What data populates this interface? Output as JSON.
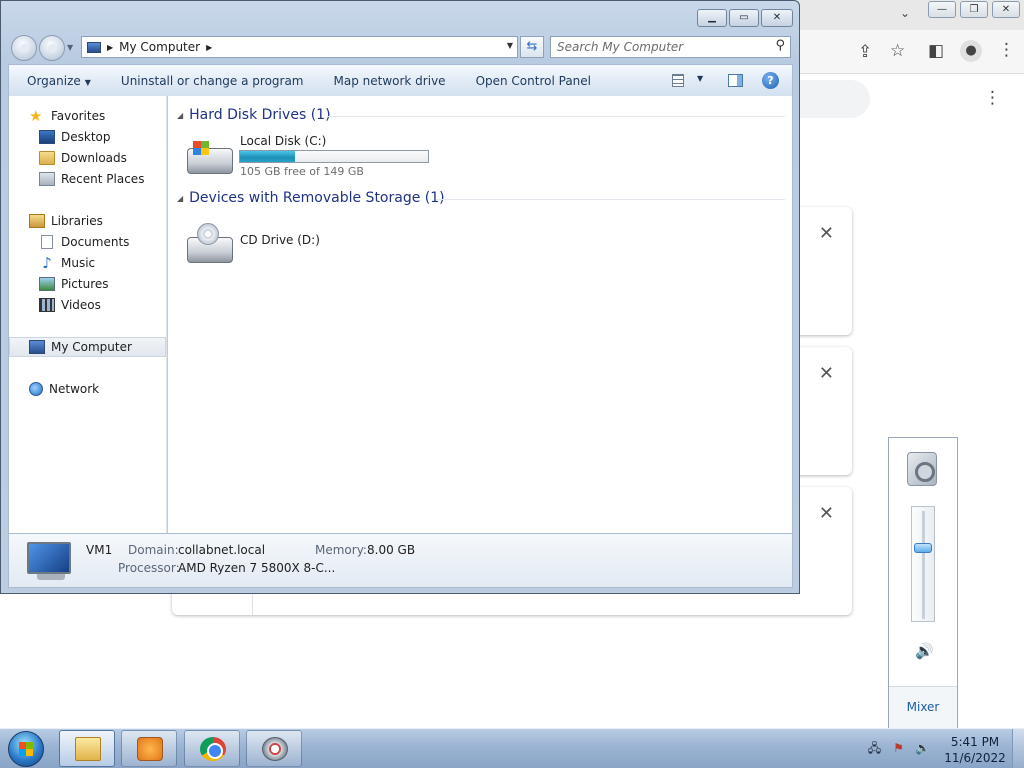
{
  "explorer": {
    "address": {
      "location": "My Computer"
    },
    "search": {
      "placeholder": "Search My Computer"
    },
    "toolbar": {
      "organize": "Organize",
      "uninstall": "Uninstall or change a program",
      "map_drive": "Map network drive",
      "control_panel": "Open Control Panel"
    },
    "nav": {
      "favorites": "Favorites",
      "desktop": "Desktop",
      "downloads": "Downloads",
      "recent": "Recent Places",
      "libraries": "Libraries",
      "documents": "Documents",
      "music": "Music",
      "pictures": "Pictures",
      "videos": "Videos",
      "computer": "My Computer",
      "network": "Network"
    },
    "groups": {
      "hdd_title": "Hard Disk Drives (1)",
      "removable_title": "Devices with Removable Storage (1)"
    },
    "drives": {
      "c_name": "Local Disk (C:)",
      "c_free": "105 GB free of 149 GB",
      "c_used_fraction": 0.295,
      "d_name": "CD Drive (D:)"
    },
    "details": {
      "computer_name": "VM1",
      "domain_label": "Domain:",
      "domain": "collabnet.local",
      "memory_label": "Memory:",
      "memory": "8.00 GB",
      "processor_label": "Processor:",
      "processor": "AMD Ryzen 7 5800X 8-C..."
    }
  },
  "volume": {
    "level_fraction": 0.66,
    "mixer_label": "Mixer"
  },
  "taskbar": {
    "time": "5:41 PM",
    "date": "11/6/2022"
  },
  "icons": {
    "background_close": "close-icon",
    "chrome_menu": "kebab-menu-icon"
  }
}
